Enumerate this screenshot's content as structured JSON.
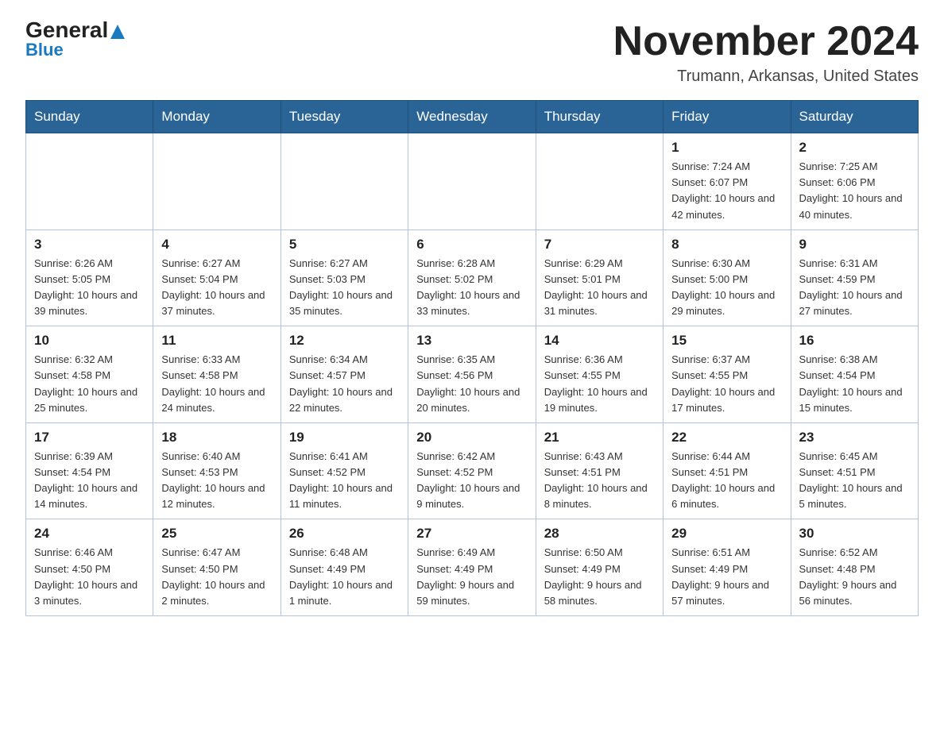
{
  "header": {
    "logo_main": "General",
    "logo_sub": "Blue",
    "month_title": "November 2024",
    "location": "Trumann, Arkansas, United States"
  },
  "days_of_week": [
    "Sunday",
    "Monday",
    "Tuesday",
    "Wednesday",
    "Thursday",
    "Friday",
    "Saturday"
  ],
  "weeks": [
    [
      {
        "day": "",
        "info": ""
      },
      {
        "day": "",
        "info": ""
      },
      {
        "day": "",
        "info": ""
      },
      {
        "day": "",
        "info": ""
      },
      {
        "day": "",
        "info": ""
      },
      {
        "day": "1",
        "info": "Sunrise: 7:24 AM\nSunset: 6:07 PM\nDaylight: 10 hours and 42 minutes."
      },
      {
        "day": "2",
        "info": "Sunrise: 7:25 AM\nSunset: 6:06 PM\nDaylight: 10 hours and 40 minutes."
      }
    ],
    [
      {
        "day": "3",
        "info": "Sunrise: 6:26 AM\nSunset: 5:05 PM\nDaylight: 10 hours and 39 minutes."
      },
      {
        "day": "4",
        "info": "Sunrise: 6:27 AM\nSunset: 5:04 PM\nDaylight: 10 hours and 37 minutes."
      },
      {
        "day": "5",
        "info": "Sunrise: 6:27 AM\nSunset: 5:03 PM\nDaylight: 10 hours and 35 minutes."
      },
      {
        "day": "6",
        "info": "Sunrise: 6:28 AM\nSunset: 5:02 PM\nDaylight: 10 hours and 33 minutes."
      },
      {
        "day": "7",
        "info": "Sunrise: 6:29 AM\nSunset: 5:01 PM\nDaylight: 10 hours and 31 minutes."
      },
      {
        "day": "8",
        "info": "Sunrise: 6:30 AM\nSunset: 5:00 PM\nDaylight: 10 hours and 29 minutes."
      },
      {
        "day": "9",
        "info": "Sunrise: 6:31 AM\nSunset: 4:59 PM\nDaylight: 10 hours and 27 minutes."
      }
    ],
    [
      {
        "day": "10",
        "info": "Sunrise: 6:32 AM\nSunset: 4:58 PM\nDaylight: 10 hours and 25 minutes."
      },
      {
        "day": "11",
        "info": "Sunrise: 6:33 AM\nSunset: 4:58 PM\nDaylight: 10 hours and 24 minutes."
      },
      {
        "day": "12",
        "info": "Sunrise: 6:34 AM\nSunset: 4:57 PM\nDaylight: 10 hours and 22 minutes."
      },
      {
        "day": "13",
        "info": "Sunrise: 6:35 AM\nSunset: 4:56 PM\nDaylight: 10 hours and 20 minutes."
      },
      {
        "day": "14",
        "info": "Sunrise: 6:36 AM\nSunset: 4:55 PM\nDaylight: 10 hours and 19 minutes."
      },
      {
        "day": "15",
        "info": "Sunrise: 6:37 AM\nSunset: 4:55 PM\nDaylight: 10 hours and 17 minutes."
      },
      {
        "day": "16",
        "info": "Sunrise: 6:38 AM\nSunset: 4:54 PM\nDaylight: 10 hours and 15 minutes."
      }
    ],
    [
      {
        "day": "17",
        "info": "Sunrise: 6:39 AM\nSunset: 4:54 PM\nDaylight: 10 hours and 14 minutes."
      },
      {
        "day": "18",
        "info": "Sunrise: 6:40 AM\nSunset: 4:53 PM\nDaylight: 10 hours and 12 minutes."
      },
      {
        "day": "19",
        "info": "Sunrise: 6:41 AM\nSunset: 4:52 PM\nDaylight: 10 hours and 11 minutes."
      },
      {
        "day": "20",
        "info": "Sunrise: 6:42 AM\nSunset: 4:52 PM\nDaylight: 10 hours and 9 minutes."
      },
      {
        "day": "21",
        "info": "Sunrise: 6:43 AM\nSunset: 4:51 PM\nDaylight: 10 hours and 8 minutes."
      },
      {
        "day": "22",
        "info": "Sunrise: 6:44 AM\nSunset: 4:51 PM\nDaylight: 10 hours and 6 minutes."
      },
      {
        "day": "23",
        "info": "Sunrise: 6:45 AM\nSunset: 4:51 PM\nDaylight: 10 hours and 5 minutes."
      }
    ],
    [
      {
        "day": "24",
        "info": "Sunrise: 6:46 AM\nSunset: 4:50 PM\nDaylight: 10 hours and 3 minutes."
      },
      {
        "day": "25",
        "info": "Sunrise: 6:47 AM\nSunset: 4:50 PM\nDaylight: 10 hours and 2 minutes."
      },
      {
        "day": "26",
        "info": "Sunrise: 6:48 AM\nSunset: 4:49 PM\nDaylight: 10 hours and 1 minute."
      },
      {
        "day": "27",
        "info": "Sunrise: 6:49 AM\nSunset: 4:49 PM\nDaylight: 9 hours and 59 minutes."
      },
      {
        "day": "28",
        "info": "Sunrise: 6:50 AM\nSunset: 4:49 PM\nDaylight: 9 hours and 58 minutes."
      },
      {
        "day": "29",
        "info": "Sunrise: 6:51 AM\nSunset: 4:49 PM\nDaylight: 9 hours and 57 minutes."
      },
      {
        "day": "30",
        "info": "Sunrise: 6:52 AM\nSunset: 4:48 PM\nDaylight: 9 hours and 56 minutes."
      }
    ]
  ]
}
